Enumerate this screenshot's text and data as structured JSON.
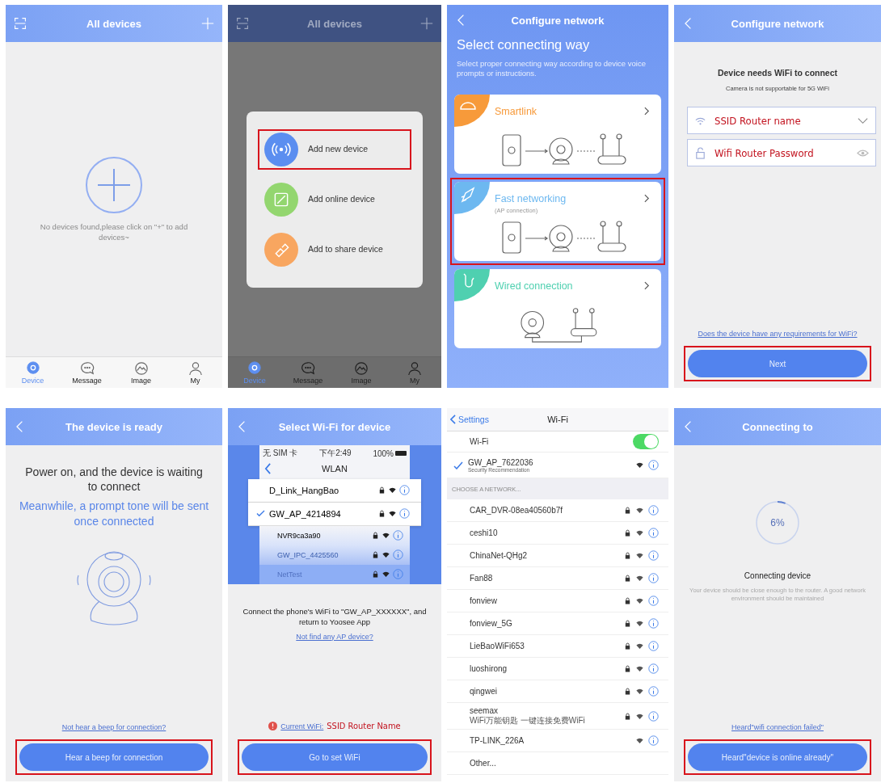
{
  "panels": [
    {
      "kind": "device_list",
      "header": {
        "title": "All devices"
      },
      "empty_message": "No devices found,please click on \"+\" to add devices~",
      "tabs": [
        {
          "label": "Device",
          "selected": true
        },
        {
          "label": "Message",
          "selected": false
        },
        {
          "label": "Image",
          "selected": false
        },
        {
          "label": "My",
          "selected": false
        }
      ]
    },
    {
      "kind": "add_menu",
      "header": {
        "title": "All devices"
      },
      "menu": [
        {
          "label": "Add new device",
          "color": "#5b8ef0",
          "highlighted": true
        },
        {
          "label": "Add online device",
          "color": "#93d66f",
          "highlighted": false
        },
        {
          "label": "Add to share device",
          "color": "#f8a660",
          "highlighted": false
        }
      ],
      "tabs": [
        {
          "label": "Device",
          "selected": true
        },
        {
          "label": "Message",
          "selected": false
        },
        {
          "label": "Image",
          "selected": false
        },
        {
          "label": "My",
          "selected": false
        }
      ]
    },
    {
      "kind": "connect_way",
      "header": {
        "title": "Configure network"
      },
      "title": "Select connecting way",
      "subtitle": "Select proper connecting way according to device voice prompts or instructions.",
      "options": [
        {
          "kind": "wireless",
          "title": "Smartlink",
          "color": "#f79a3a",
          "highlighted": false
        },
        {
          "kind": "wireless",
          "title": "Fast networking",
          "note": "(AP connection)",
          "color": "#6db8f0",
          "highlighted": true
        },
        {
          "kind": "wired",
          "title": "Wired connection",
          "color": "#4fd0b0",
          "highlighted": false
        }
      ]
    },
    {
      "kind": "wifi_form",
      "header": {
        "title": "Configure network"
      },
      "heading": "Device needs WiFi to connect",
      "note": "Camera is not supportable for 5G WiFi",
      "ssid": {
        "value": "SSID Router name"
      },
      "password": {
        "value": "Wifi Router Password"
      },
      "link": "Does the device have any requirements for WiFi?",
      "button": {
        "label": "Next",
        "highlighted": true
      }
    },
    {
      "kind": "device_ready",
      "header": {
        "title": "The device is ready"
      },
      "heading": "Power on, and the device is waiting to connect",
      "prompt": "Meanwhile, a prompt tone will be sent once connected",
      "link": "Not hear a beep for connection?",
      "button": {
        "label": "Hear a beep for connection",
        "highlighted": true
      }
    },
    {
      "kind": "select_wifi",
      "header": {
        "title": "Select Wi-Fi for device"
      },
      "phone": {
        "carrier": "无 SIM 卡",
        "time": "下午2:49",
        "battery": "100%",
        "title": "WLAN",
        "networks": [
          {
            "name": "D_Link_HangBao",
            "selected": false
          },
          {
            "name": "GW_AP_4214894",
            "selected": true
          },
          {
            "name": "NVR9ca3a90",
            "selected": false
          },
          {
            "name": "GW_IPC_4425560",
            "selected": false
          },
          {
            "name": "NetTest",
            "selected": false
          }
        ]
      },
      "instruction": "Connect the phone's WiFi to \"GW_AP_XXXXXX\", and return to  Yoosee  App",
      "link": "Not find any AP device?",
      "current_label": "Current WiFi:",
      "current_value": "SSID Router Name",
      "button": {
        "label": "Go to set WiFi",
        "highlighted": true
      }
    },
    {
      "kind": "ios_wifi",
      "back": "Settings",
      "title": "Wi-Fi",
      "toggle": {
        "label": "Wi-Fi",
        "on": true
      },
      "connected": {
        "name": "GW_AP_7622036",
        "sub": "Security Recommendation"
      },
      "section": "CHOOSE A NETWORK...",
      "networks": [
        {
          "name": "CAR_DVR-08ea40560b7f",
          "locked": true
        },
        {
          "name": "ceshi10",
          "locked": true
        },
        {
          "name": "ChinaNet-QHg2",
          "locked": true
        },
        {
          "name": "Fan88",
          "locked": true
        },
        {
          "name": "fonview",
          "locked": true
        },
        {
          "name": "fonview_5G",
          "locked": true
        },
        {
          "name": "LieBaoWiFi653",
          "locked": true
        },
        {
          "name": "luoshirong",
          "locked": true
        },
        {
          "name": "qingwei",
          "locked": true
        },
        {
          "name": "seemax",
          "sub": "WiFi万能钥匙 一键连接免费WiFi",
          "locked": true
        },
        {
          "name": "TP-LINK_226A",
          "locked": false
        }
      ],
      "other": "Other..."
    },
    {
      "kind": "connecting",
      "header": {
        "title": "Connecting to"
      },
      "progress": {
        "level": 0.06,
        "reading": "6%"
      },
      "status": "Connecting device",
      "hint": "Your device should be close enough to the router. A good network environment should be maintained",
      "link": "Heard\"wifi connection failed\"",
      "button": {
        "label": "Heard\"device is online already\"",
        "highlighted": true
      }
    }
  ]
}
